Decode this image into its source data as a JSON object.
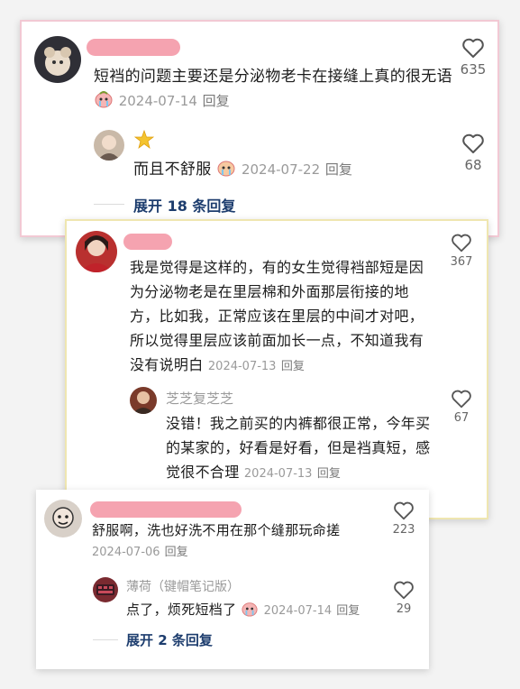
{
  "comments": [
    {
      "text": "短裆的问题主要还是分泌物老卡在接缝上真的很无语",
      "date": "2024-07-14",
      "reply_label": "回复",
      "likes": "635",
      "reply": {
        "name_emoji": "🌟",
        "text": "而且不舒服",
        "date": "2024-07-22",
        "reply_label": "回复",
        "likes": "68"
      },
      "expand_label": "展开 18 条回复"
    },
    {
      "text": "我是觉得是这样的，有的女生觉得裆部短是因为分泌物老是在里层棉和外面那层衔接的地方，比如我，正常应该在里层的中间才对吧，所以觉得里层应该前面加长一点，不知道我有没有说明白",
      "date": "2024-07-13",
      "reply_label": "回复",
      "likes": "367",
      "reply": {
        "name": "芝芝复芝芝",
        "text": "没错！我之前买的内裤都很正常，今年买的某家的，好看是好看，但是裆真短，感觉很不合理",
        "date": "2024-07-13",
        "reply_label": "回复",
        "likes": "67"
      }
    },
    {
      "text": "舒服啊，洗也好洗不用在那个缝那玩命搓",
      "date": "2024-07-06",
      "reply_label": "回复",
      "likes": "223",
      "reply": {
        "name": "薄荷（键帽笔记版）",
        "text": "点了，烦死短档了",
        "date": "2024-07-14",
        "reply_label": "回复",
        "likes": "29"
      },
      "expand_label": "展开 2 条回复"
    }
  ],
  "colors": {
    "redacted_name": "#f5a3b0",
    "expand_text": "#1d3d6e",
    "card1_border": "#f2c9d4",
    "card2_border": "#efe6b0"
  },
  "icons": {
    "like": "heart-outline-icon",
    "emoji": "crying-face-emoji"
  }
}
